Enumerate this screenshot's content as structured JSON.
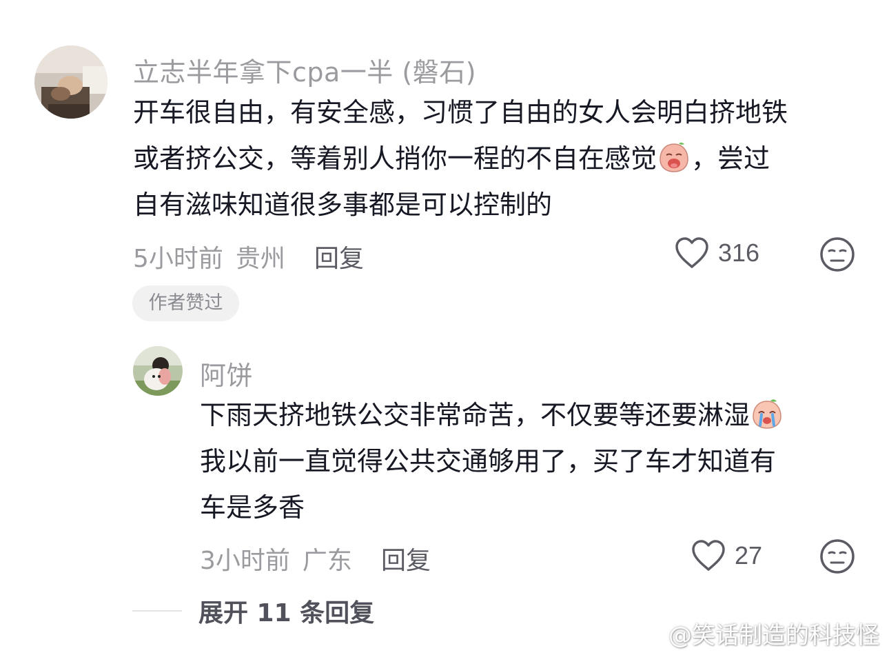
{
  "comment": {
    "username": "立志半年拿下cpa一半 (磐石)",
    "text_lines": [
      "开车很自由，有安全感，习惯了自由的女人会明白挤地铁",
      "或者挤公交，等着别人捎你一程的不自在感觉",
      "，尝过",
      "自有滋味知道很多事都是可以控制的"
    ],
    "emoji_icon": "crying-face-emoji",
    "time": "5小时前",
    "location": "贵州",
    "reply_label": "回复",
    "like_count": "316",
    "author_badge": "作者赞过"
  },
  "reply": {
    "username": "阿饼",
    "text_lines": [
      "下雨天挤地铁公交非常命苦，不仅要等还要淋湿",
      "我以前一直觉得公共交通够用了，买了车才知道有",
      "车是多香"
    ],
    "emoji_icon": "tearful-face-emoji",
    "time": "3小时前",
    "location": "广东",
    "reply_label": "回复",
    "like_count": "27"
  },
  "expand": {
    "label": "展开 11 条回复"
  },
  "watermark": {
    "text": "@笑话制造的科技怪"
  },
  "colors": {
    "text_primary": "#161823",
    "text_secondary": "#9a9a9f",
    "badge_bg": "#f1f1f2"
  }
}
